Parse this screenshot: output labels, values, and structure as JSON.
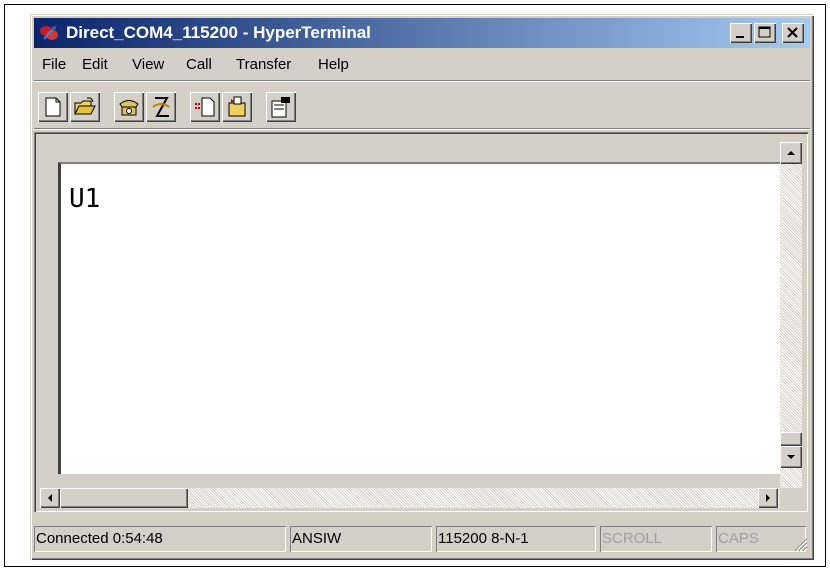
{
  "window": {
    "title": "Direct_COM4_115200 - HyperTerminal"
  },
  "menu": [
    "File",
    "Edit",
    "View",
    "Call",
    "Transfer",
    "Help"
  ],
  "toolbar": [
    "new-connection-icon",
    "open-icon",
    "call-phone-icon",
    "disconnect-phone-icon",
    "send-file-icon",
    "receive-file-icon",
    "properties-icon"
  ],
  "terminal": {
    "text": "U1"
  },
  "status": {
    "connection": "Connected 0:54:48",
    "emulation": "ANSIW",
    "port_settings": "115200 8-N-1",
    "scroll": "SCROLL",
    "caps": "CAPS"
  },
  "colors": {
    "titlebar_start": "#0a246a",
    "titlebar_end": "#a6caf0",
    "face": "#d4d0c8"
  }
}
